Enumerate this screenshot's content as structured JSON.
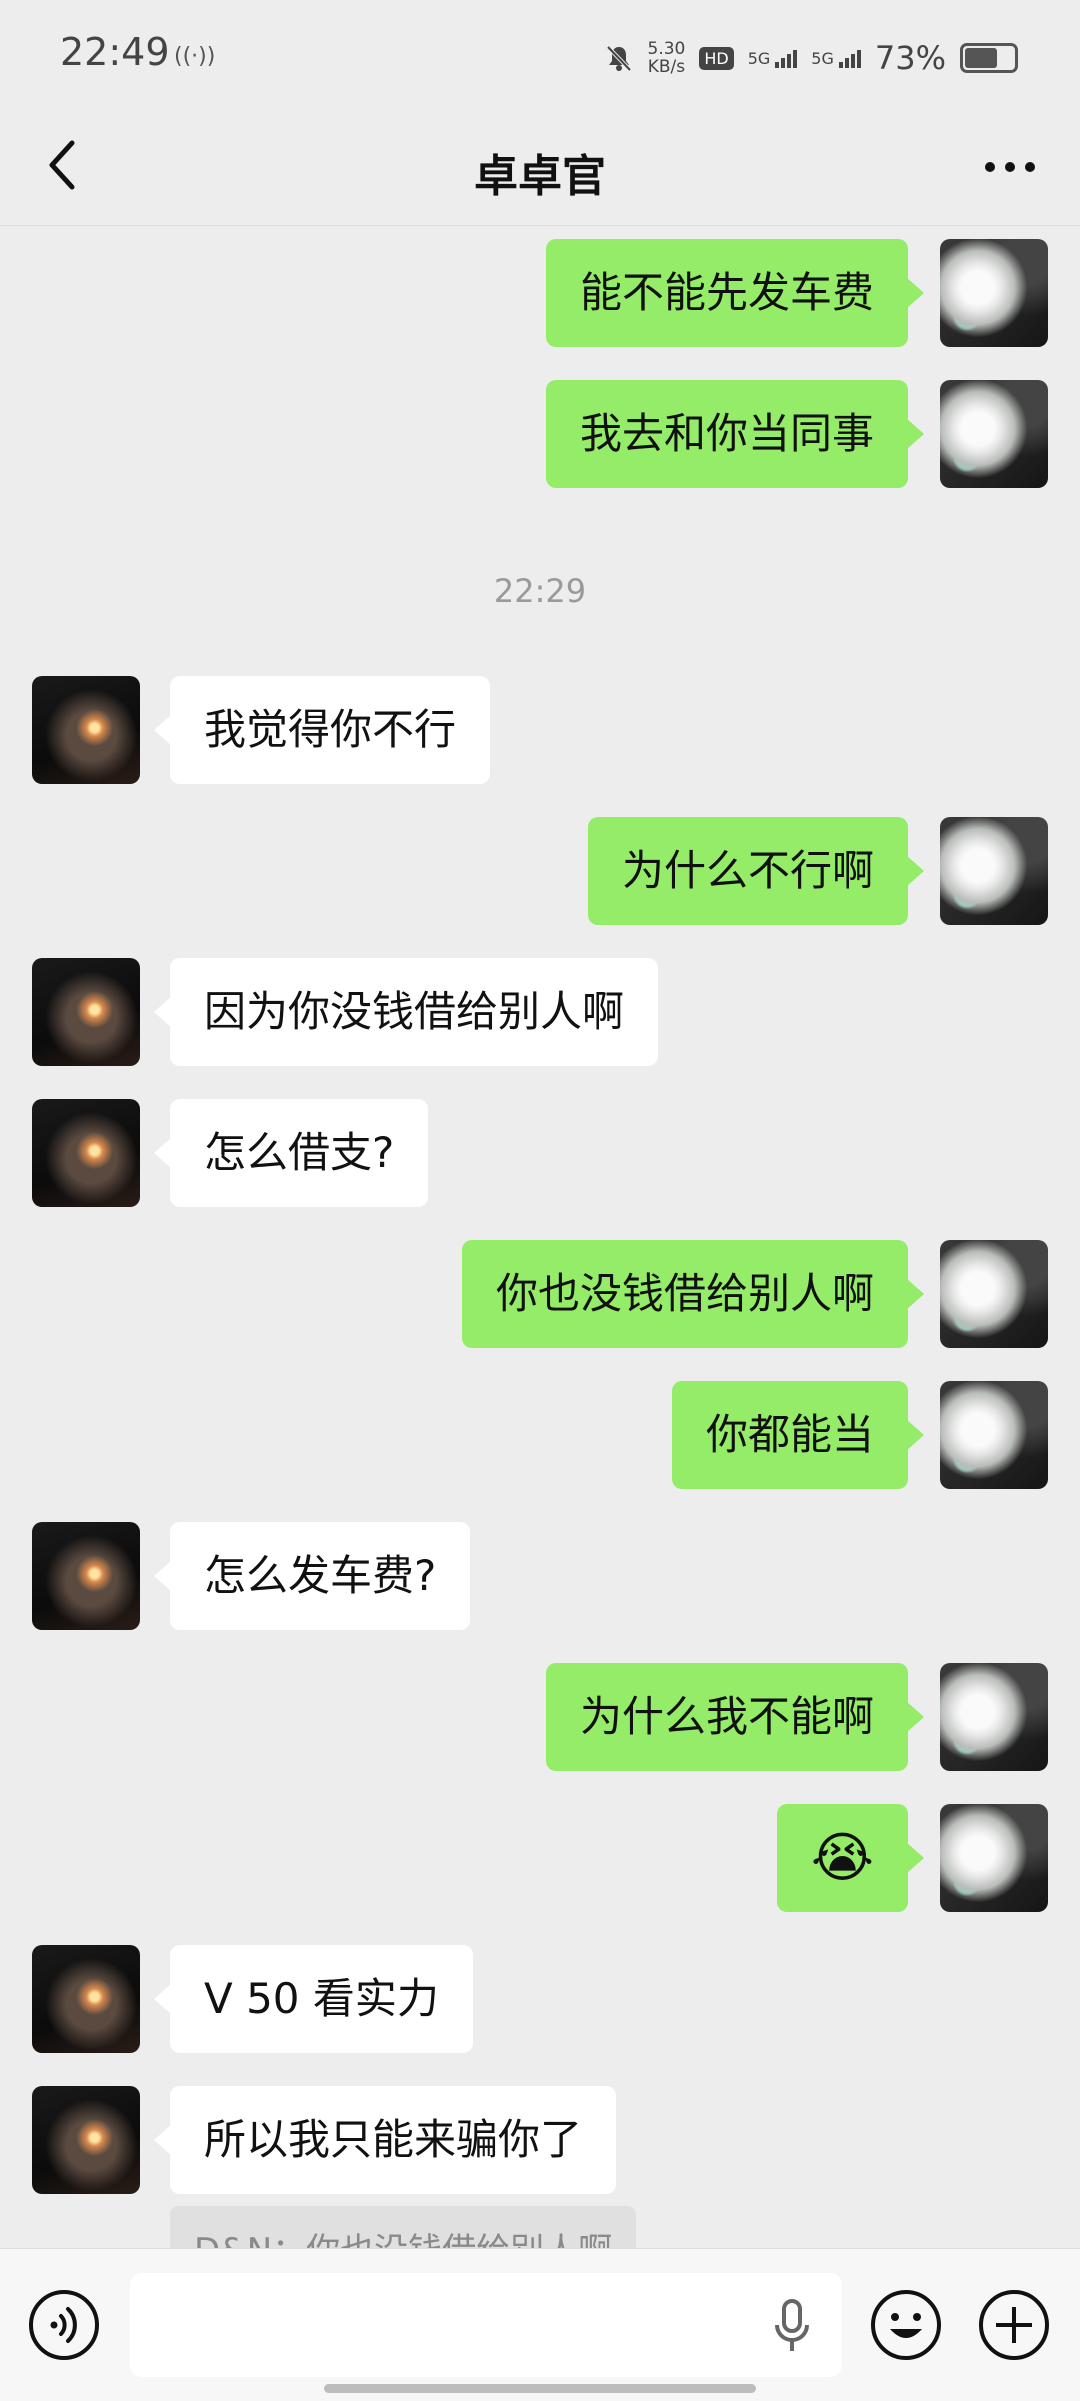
{
  "status_bar": {
    "time": "22:49",
    "net_speed_value": "5.30",
    "net_speed_unit": "KB/s",
    "hd_label": "HD",
    "sim1_label": "5G",
    "sim2_label": "5G",
    "battery_percent": "73%",
    "battery_level": 0.73
  },
  "header": {
    "title": "卓卓官",
    "back_icon": "chevron-left-icon",
    "more_icon": "more-dots-icon"
  },
  "messages": [
    {
      "sender": "me",
      "text": "能不能先发车费"
    },
    {
      "sender": "me",
      "text": "我去和你当同事"
    },
    {
      "timestamp": "22:29"
    },
    {
      "sender": "other",
      "text": "我觉得你不行"
    },
    {
      "sender": "me",
      "text": "为什么不行啊"
    },
    {
      "sender": "other",
      "text": "因为你没钱借给别人啊"
    },
    {
      "sender": "other",
      "text": "怎么借支?"
    },
    {
      "sender": "me",
      "text": "你也没钱借给别人啊"
    },
    {
      "sender": "me",
      "text": "你都能当"
    },
    {
      "sender": "other",
      "text": "怎么发车费?"
    },
    {
      "sender": "me",
      "text": "为什么我不能啊"
    },
    {
      "sender": "me",
      "text": "😭",
      "type": "emoji"
    },
    {
      "sender": "other",
      "text": "V 50 看实力"
    },
    {
      "sender": "other",
      "text": "所以我只能来骗你了"
    }
  ],
  "quote": {
    "text": "D&N：你也没钱借给别人啊"
  },
  "input_bar": {
    "voice_icon": "voice-icon",
    "input_value": "",
    "mic_icon": "mic-icon",
    "emoji_icon": "emoji-icon",
    "plus_icon": "plus-icon"
  }
}
